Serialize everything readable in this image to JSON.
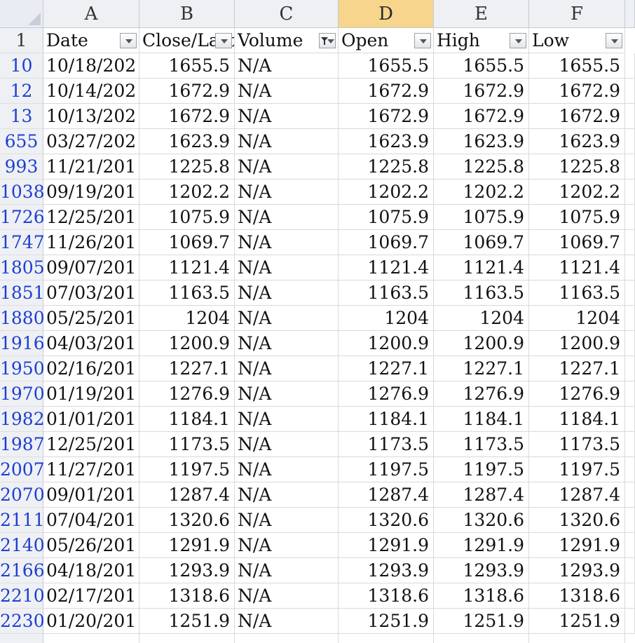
{
  "columns": [
    {
      "letter": "A",
      "header": "Date"
    },
    {
      "letter": "B",
      "header": "Close/Last"
    },
    {
      "letter": "C",
      "header": "Volume"
    },
    {
      "letter": "D",
      "header": "Open"
    },
    {
      "letter": "E",
      "header": "High"
    },
    {
      "letter": "F",
      "header": "Low"
    }
  ],
  "selected_column": "D",
  "header_row_number": "1",
  "active_filter_column": "C",
  "rows": [
    {
      "row": "10",
      "date": "10/18/202",
      "close": "1655.5",
      "volume": "N/A",
      "open": "1655.5",
      "high": "1655.5",
      "low": "1655.5"
    },
    {
      "row": "12",
      "date": "10/14/202",
      "close": "1672.9",
      "volume": "N/A",
      "open": "1672.9",
      "high": "1672.9",
      "low": "1672.9"
    },
    {
      "row": "13",
      "date": "10/13/202",
      "close": "1672.9",
      "volume": "N/A",
      "open": "1672.9",
      "high": "1672.9",
      "low": "1672.9"
    },
    {
      "row": "655",
      "date": "03/27/202",
      "close": "1623.9",
      "volume": "N/A",
      "open": "1623.9",
      "high": "1623.9",
      "low": "1623.9"
    },
    {
      "row": "993",
      "date": "11/21/201",
      "close": "1225.8",
      "volume": "N/A",
      "open": "1225.8",
      "high": "1225.8",
      "low": "1225.8"
    },
    {
      "row": "1038",
      "date": "09/19/201",
      "close": "1202.2",
      "volume": "N/A",
      "open": "1202.2",
      "high": "1202.2",
      "low": "1202.2"
    },
    {
      "row": "1726",
      "date": "12/25/201",
      "close": "1075.9",
      "volume": "N/A",
      "open": "1075.9",
      "high": "1075.9",
      "low": "1075.9"
    },
    {
      "row": "1747",
      "date": "11/26/201",
      "close": "1069.7",
      "volume": "N/A",
      "open": "1069.7",
      "high": "1069.7",
      "low": "1069.7"
    },
    {
      "row": "1805",
      "date": "09/07/201",
      "close": "1121.4",
      "volume": "N/A",
      "open": "1121.4",
      "high": "1121.4",
      "low": "1121.4"
    },
    {
      "row": "1851",
      "date": "07/03/201",
      "close": "1163.5",
      "volume": "N/A",
      "open": "1163.5",
      "high": "1163.5",
      "low": "1163.5"
    },
    {
      "row": "1880",
      "date": "05/25/201",
      "close": "1204",
      "volume": "N/A",
      "open": "1204",
      "high": "1204",
      "low": "1204"
    },
    {
      "row": "1916",
      "date": "04/03/201",
      "close": "1200.9",
      "volume": "N/A",
      "open": "1200.9",
      "high": "1200.9",
      "low": "1200.9"
    },
    {
      "row": "1950",
      "date": "02/16/201",
      "close": "1227.1",
      "volume": "N/A",
      "open": "1227.1",
      "high": "1227.1",
      "low": "1227.1"
    },
    {
      "row": "1970",
      "date": "01/19/201",
      "close": "1276.9",
      "volume": "N/A",
      "open": "1276.9",
      "high": "1276.9",
      "low": "1276.9"
    },
    {
      "row": "1982",
      "date": "01/01/201",
      "close": "1184.1",
      "volume": "N/A",
      "open": "1184.1",
      "high": "1184.1",
      "low": "1184.1"
    },
    {
      "row": "1987",
      "date": "12/25/201",
      "close": "1173.5",
      "volume": "N/A",
      "open": "1173.5",
      "high": "1173.5",
      "low": "1173.5"
    },
    {
      "row": "2007",
      "date": "11/27/201",
      "close": "1197.5",
      "volume": "N/A",
      "open": "1197.5",
      "high": "1197.5",
      "low": "1197.5"
    },
    {
      "row": "2070",
      "date": "09/01/201",
      "close": "1287.4",
      "volume": "N/A",
      "open": "1287.4",
      "high": "1287.4",
      "low": "1287.4"
    },
    {
      "row": "2111",
      "date": "07/04/201",
      "close": "1320.6",
      "volume": "N/A",
      "open": "1320.6",
      "high": "1320.6",
      "low": "1320.6"
    },
    {
      "row": "2140",
      "date": "05/26/201",
      "close": "1291.9",
      "volume": "N/A",
      "open": "1291.9",
      "high": "1291.9",
      "low": "1291.9"
    },
    {
      "row": "2166",
      "date": "04/18/201",
      "close": "1293.9",
      "volume": "N/A",
      "open": "1293.9",
      "high": "1293.9",
      "low": "1293.9"
    },
    {
      "row": "2210",
      "date": "02/17/201",
      "close": "1318.6",
      "volume": "N/A",
      "open": "1318.6",
      "high": "1318.6",
      "low": "1318.6"
    },
    {
      "row": "2230",
      "date": "01/20/201",
      "close": "1251.9",
      "volume": "N/A",
      "open": "1251.9",
      "high": "1251.9",
      "low": "1251.9"
    }
  ],
  "colors": {
    "header_bg": "#eef0f4",
    "selected_header": "#f7d58c",
    "row_number": "#1e3fd0",
    "gridline": "#d9d9d9"
  }
}
